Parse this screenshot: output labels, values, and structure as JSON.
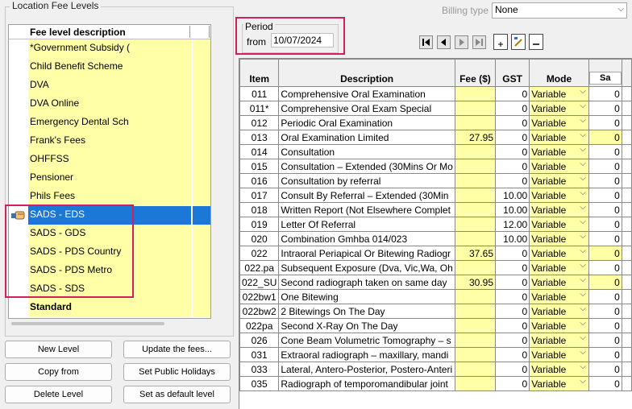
{
  "location_group": {
    "title": "Location Fee Levels",
    "column_header": "Fee level description",
    "levels": [
      {
        "label": "*Government Subsidy (",
        "selected": false,
        "bold": false
      },
      {
        "label": "Child Benefit Scheme",
        "selected": false,
        "bold": false
      },
      {
        "label": "DVA",
        "selected": false,
        "bold": false
      },
      {
        "label": "DVA Online",
        "selected": false,
        "bold": false
      },
      {
        "label": "Emergency Dental Sch",
        "selected": false,
        "bold": false
      },
      {
        "label": "Frank's Fees",
        "selected": false,
        "bold": false
      },
      {
        "label": "OHFFSS",
        "selected": false,
        "bold": false
      },
      {
        "label": "Pensioner",
        "selected": false,
        "bold": false
      },
      {
        "label": "Phils Fees",
        "selected": false,
        "bold": false
      },
      {
        "label": "SADS - EDS",
        "selected": true,
        "bold": false
      },
      {
        "label": "SADS - GDS",
        "selected": false,
        "bold": false
      },
      {
        "label": "SADS - PDS Country",
        "selected": false,
        "bold": false
      },
      {
        "label": "SADS - PDS Metro",
        "selected": false,
        "bold": false
      },
      {
        "label": "SADS - SDS",
        "selected": false,
        "bold": false
      },
      {
        "label": "Standard",
        "selected": false,
        "bold": true
      }
    ]
  },
  "buttons": {
    "new_level": "New Level",
    "update_fees": "Update the fees...",
    "copy_from": "Copy from",
    "set_public_holidays": "Set Public Holidays",
    "delete_level": "Delete Level",
    "set_default": "Set as default level"
  },
  "period": {
    "title": "Period",
    "from_label": "from",
    "from_value": "10/07/2024"
  },
  "billing": {
    "label": "Billing type",
    "value": "None"
  },
  "grid": {
    "headers": {
      "item": "Item",
      "description": "Description",
      "fee": "Fee ($)",
      "gst": "GST",
      "mode": "Mode",
      "sat": "Sa"
    },
    "rows": [
      {
        "item": "011",
        "description": "Comprehensive Oral Examination",
        "fee": "",
        "gst": "0",
        "mode": "Variable",
        "sat": "0",
        "sat_yellow": false
      },
      {
        "item": "011*",
        "description": "Comprehensive Oral Exam Special",
        "fee": "",
        "gst": "0",
        "mode": "Variable",
        "sat": "0",
        "sat_yellow": false
      },
      {
        "item": "012",
        "description": "Periodic Oral Examination",
        "fee": "",
        "gst": "0",
        "mode": "Variable",
        "sat": "0",
        "sat_yellow": false
      },
      {
        "item": "013",
        "description": "Oral Examination Limited",
        "fee": "27.95",
        "gst": "0",
        "mode": "Variable",
        "sat": "0",
        "sat_yellow": true
      },
      {
        "item": "014",
        "description": "Consultation",
        "fee": "",
        "gst": "0",
        "mode": "Variable",
        "sat": "0",
        "sat_yellow": false
      },
      {
        "item": "015",
        "description": "Consultation – Extended (30Mins Or Mo",
        "fee": "",
        "gst": "0",
        "mode": "Variable",
        "sat": "0",
        "sat_yellow": false
      },
      {
        "item": "016",
        "description": "Consultation by referral",
        "fee": "",
        "gst": "0",
        "mode": "Variable",
        "sat": "0",
        "sat_yellow": false
      },
      {
        "item": "017",
        "description": "Consult By Referral – Extended  (30Min",
        "fee": "",
        "gst": "10.00",
        "mode": "Variable",
        "sat": "0",
        "sat_yellow": false
      },
      {
        "item": "018",
        "description": "Written Report (Not Elsewhere Complet",
        "fee": "",
        "gst": "10.00",
        "mode": "Variable",
        "sat": "0",
        "sat_yellow": false
      },
      {
        "item": "019",
        "description": "Letter Of Referral",
        "fee": "",
        "gst": "12.00",
        "mode": "Variable",
        "sat": "0",
        "sat_yellow": false
      },
      {
        "item": "020",
        "description": "Combination Gmhba 014/023",
        "fee": "",
        "gst": "10.00",
        "mode": "Variable",
        "sat": "0",
        "sat_yellow": false
      },
      {
        "item": "022",
        "description": "Intraoral Periapical Or Bitewing Radiogr",
        "fee": "37.65",
        "gst": "0",
        "mode": "Variable",
        "sat": "0",
        "sat_yellow": true
      },
      {
        "item": "022.pa",
        "description": "Subsequent Exposure (Dva, Vic,Wa, Oh",
        "fee": "",
        "gst": "0",
        "mode": "Variable",
        "sat": "0",
        "sat_yellow": false
      },
      {
        "item": "022_SU",
        "description": "Second radiograph taken on same day",
        "fee": "30.95",
        "gst": "0",
        "mode": "Variable",
        "sat": "0",
        "sat_yellow": true
      },
      {
        "item": "022bw1",
        "description": "One Bitewing",
        "fee": "",
        "gst": "0",
        "mode": "Variable",
        "sat": "0",
        "sat_yellow": false
      },
      {
        "item": "022bw2",
        "description": "2 Bitewings On The Day",
        "fee": "",
        "gst": "0",
        "mode": "Variable",
        "sat": "0",
        "sat_yellow": false
      },
      {
        "item": "022pa",
        "description": "Second X-Ray On The Day",
        "fee": "",
        "gst": "0",
        "mode": "Variable",
        "sat": "0",
        "sat_yellow": false
      },
      {
        "item": "026",
        "description": "Cone Beam Volumetric Tomography – s",
        "fee": "",
        "gst": "0",
        "mode": "Variable",
        "sat": "0",
        "sat_yellow": false
      },
      {
        "item": "031",
        "description": " Extraoral radiograph – maxillary, mandi",
        "fee": "",
        "gst": "0",
        "mode": "Variable",
        "sat": "0",
        "sat_yellow": false
      },
      {
        "item": "033",
        "description": "Lateral, Antero-Posterior, Postero-Anteri",
        "fee": "",
        "gst": "0",
        "mode": "Variable",
        "sat": "0",
        "sat_yellow": false
      },
      {
        "item": "035",
        "description": "Radiograph of temporomandibular joint",
        "fee": "",
        "gst": "0",
        "mode": "Variable",
        "sat": "0",
        "sat_yellow": false
      }
    ]
  },
  "colors": {
    "field_yellow": "#ffffa8",
    "selection_blue": "#1b78d6",
    "highlight_border": "#d21f5e"
  }
}
